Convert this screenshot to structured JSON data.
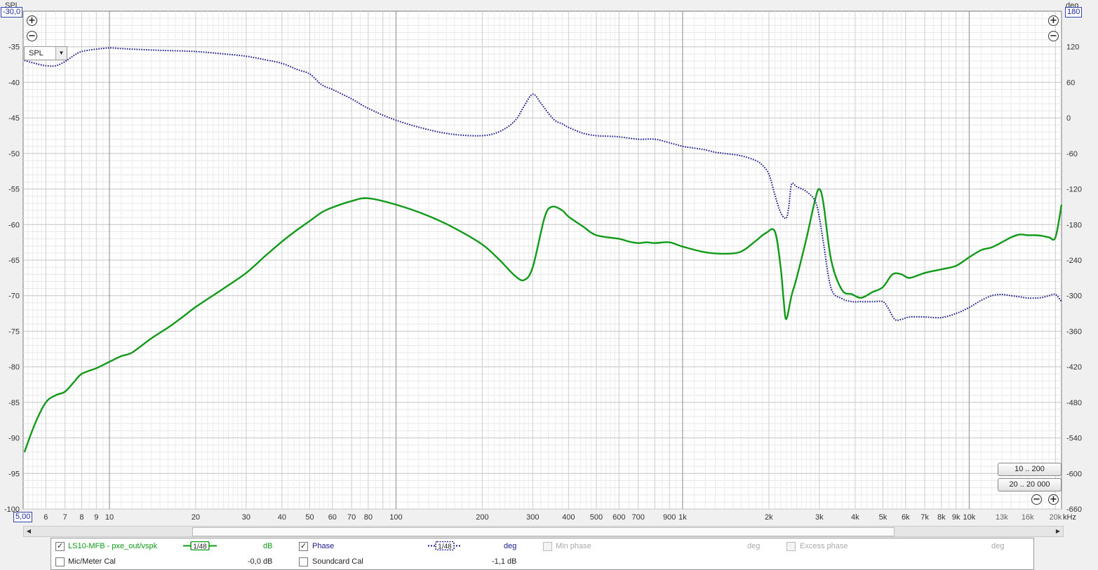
{
  "left_axis": {
    "label": "SPL",
    "top_value": "-30,0"
  },
  "right_axis": {
    "label": "deg",
    "top_value": "180"
  },
  "x_axis": {
    "start_value": "5,00",
    "unit": "kHz"
  },
  "display_select": {
    "value": "SPL"
  },
  "range_buttons": [
    "10 .. 200",
    "20 .. 20 000"
  ],
  "legend": {
    "row1": [
      {
        "checked": true,
        "label": "LS10-MFB - pxe_out/vspk",
        "smoothing": "1/48",
        "unit": "dB",
        "color": "#119a19"
      },
      {
        "checked": true,
        "label": "Phase",
        "smoothing": "1/48",
        "unit": "deg",
        "color": "#1a1a8c"
      },
      {
        "checked": false,
        "label": "Min phase",
        "unit": "deg",
        "disabled": true
      },
      {
        "checked": false,
        "label": "Excess phase",
        "unit": "deg",
        "disabled": true
      }
    ],
    "row2": [
      {
        "checked": false,
        "label": "Mic/Meter Cal",
        "value": "-0,0 dB"
      },
      {
        "checked": false,
        "label": "Soundcard Cal",
        "value": "-1,1 dB"
      }
    ]
  },
  "chart_data": {
    "type": "line",
    "x_scale": "log",
    "xlim": [
      5,
      21000
    ],
    "ylim": [
      -100,
      -30
    ],
    "y2lim": [
      -660,
      180
    ],
    "grid": true,
    "x_ticks": [
      {
        "v": 6,
        "l": "6"
      },
      {
        "v": 7,
        "l": "7"
      },
      {
        "v": 8,
        "l": "8"
      },
      {
        "v": 9,
        "l": "9"
      },
      {
        "v": 10,
        "l": "10"
      },
      {
        "v": 20,
        "l": "20"
      },
      {
        "v": 30,
        "l": "30"
      },
      {
        "v": 40,
        "l": "40"
      },
      {
        "v": 50,
        "l": "50"
      },
      {
        "v": 60,
        "l": "60"
      },
      {
        "v": 70,
        "l": "70"
      },
      {
        "v": 80,
        "l": "80"
      },
      {
        "v": 100,
        "l": "100"
      },
      {
        "v": 200,
        "l": "200"
      },
      {
        "v": 300,
        "l": "300"
      },
      {
        "v": 400,
        "l": "400"
      },
      {
        "v": 500,
        "l": "500"
      },
      {
        "v": 600,
        "l": "600"
      },
      {
        "v": 700,
        "l": "700"
      },
      {
        "v": 900,
        "l": "900"
      },
      {
        "v": 1000,
        "l": "1k"
      },
      {
        "v": 2000,
        "l": "2k"
      },
      {
        "v": 3000,
        "l": "3k"
      },
      {
        "v": 4000,
        "l": "4k"
      },
      {
        "v": 5000,
        "l": "5k"
      },
      {
        "v": 6000,
        "l": "6k"
      },
      {
        "v": 7000,
        "l": "7k"
      },
      {
        "v": 8000,
        "l": "8k"
      },
      {
        "v": 9000,
        "l": "9k"
      },
      {
        "v": 10000,
        "l": "10k"
      },
      {
        "v": 13000,
        "l": "13k"
      },
      {
        "v": 16000,
        "l": "16k"
      },
      {
        "v": 20000,
        "l": "20k"
      }
    ],
    "y_ticks": [
      -35,
      -40,
      -45,
      -50,
      -55,
      -60,
      -65,
      -70,
      -75,
      -80,
      -85,
      -90,
      -95,
      -100
    ],
    "y2_ticks": [
      120,
      60,
      0,
      -60,
      -120,
      -180,
      -240,
      -300,
      -360,
      -420,
      -480,
      -540,
      -600,
      -660
    ],
    "series": [
      {
        "name": "LS10-MFB - pxe_out/vspk",
        "axis": "left",
        "color": "#119a19",
        "dash": false,
        "x": [
          5.05,
          5.5,
          6,
          6.5,
          7,
          7.5,
          8,
          9,
          10,
          11,
          12,
          14,
          16,
          18,
          20,
          25,
          30,
          35,
          40,
          45,
          50,
          55,
          60,
          70,
          80,
          100,
          130,
          160,
          200,
          230,
          260,
          280,
          300,
          330,
          350,
          380,
          400,
          450,
          500,
          600,
          650,
          700,
          750,
          800,
          900,
          1000,
          1200,
          1400,
          1600,
          1800,
          1950,
          2100,
          2200,
          2250,
          2300,
          2400,
          2500,
          2700,
          2900,
          3000,
          3100,
          3300,
          3600,
          3900,
          4200,
          4600,
          5000,
          5400,
          5800,
          6200,
          7000,
          8000,
          9000,
          10000,
          11000,
          12000,
          13000,
          14000,
          15000,
          16000,
          17000,
          18000,
          19000,
          20000,
          21000
        ],
        "y": [
          -92,
          -88,
          -85,
          -84,
          -83.5,
          -82.2,
          -81,
          -80.2,
          -79.3,
          -78.5,
          -78,
          -76,
          -74.5,
          -73,
          -71.6,
          -69,
          -66.8,
          -64.4,
          -62.4,
          -60.8,
          -59.5,
          -58.3,
          -57.6,
          -56.7,
          -56.3,
          -57.2,
          -58.8,
          -60.5,
          -62.8,
          -65,
          -67.2,
          -67.8,
          -66,
          -59,
          -57.5,
          -58,
          -58.9,
          -60.3,
          -61.5,
          -62,
          -62.4,
          -62.6,
          -62.5,
          -62.6,
          -62.5,
          -63.1,
          -63.9,
          -64.1,
          -63.8,
          -62.3,
          -61.2,
          -61,
          -66.1,
          -70.5,
          -73.3,
          -70,
          -67.5,
          -62.1,
          -56.5,
          -55,
          -57,
          -65,
          -69.2,
          -69.8,
          -70.3,
          -69.5,
          -68.8,
          -67,
          -67,
          -67.5,
          -66.8,
          -66.3,
          -65.8,
          -64.6,
          -63.6,
          -63.2,
          -62.5,
          -61.8,
          -61.4,
          -61.5,
          -61.5,
          -61.6,
          -61.8,
          -61.8,
          -57.2
        ]
      },
      {
        "name": "Phase",
        "axis": "right",
        "color": "#1a1a8c",
        "dash": true,
        "x": [
          5.05,
          5.5,
          6,
          6.5,
          7,
          7.5,
          8,
          9,
          10,
          11,
          12,
          15,
          20,
          25,
          30,
          35,
          40,
          45,
          50,
          55,
          60,
          70,
          80,
          100,
          130,
          160,
          200,
          230,
          260,
          280,
          300,
          320,
          340,
          360,
          380,
          400,
          450,
          500,
          550,
          600,
          700,
          800,
          900,
          1000,
          1100,
          1200,
          1300,
          1400,
          1600,
          1800,
          1900,
          2000,
          2100,
          2200,
          2300,
          2350,
          2400,
          2500,
          2700,
          2900,
          3000,
          3100,
          3300,
          3600,
          3900,
          4200,
          4600,
          5000,
          5200,
          5500,
          5800,
          6200,
          7000,
          8000,
          9000,
          10000,
          11000,
          12000,
          13000,
          14000,
          15000,
          16000,
          17000,
          18000,
          19000,
          20000,
          21000
        ],
        "y": [
          97,
          92,
          88,
          88,
          95,
          105,
          112,
          116,
          118,
          117,
          116,
          114,
          112,
          108,
          104,
          98,
          92,
          82,
          74,
          56,
          48,
          32,
          16,
          -4,
          -20,
          -28,
          -30,
          -23,
          -5,
          20,
          40,
          25,
          8,
          -5,
          -10,
          -16,
          -26,
          -30,
          -31,
          -32,
          -36,
          -36,
          -42,
          -48,
          -51,
          -54,
          -58,
          -60,
          -64,
          -72,
          -80,
          -95,
          -130,
          -160,
          -169,
          -148,
          -112,
          -116,
          -124,
          -140,
          -168,
          -210,
          -288,
          -305,
          -310,
          -310,
          -310,
          -310,
          -320,
          -340,
          -340,
          -336,
          -336,
          -337,
          -330,
          -320,
          -308,
          -300,
          -298,
          -300,
          -302,
          -304,
          -304,
          -303,
          -300,
          -298,
          -310
        ]
      }
    ]
  }
}
